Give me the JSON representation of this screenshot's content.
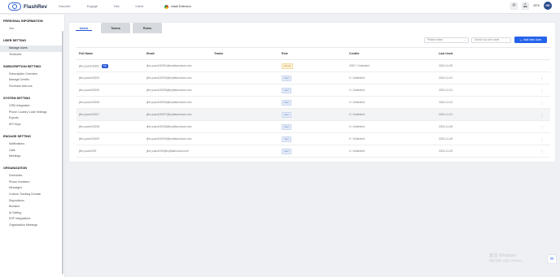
{
  "app": {
    "name": "FlashRev"
  },
  "topnav": {
    "items": [
      "Discover",
      "Engage",
      "Dial",
      "Intent"
    ]
  },
  "extension": {
    "label": "Install Extension"
  },
  "header": {
    "credits": "257K",
    "avatar_initials": "HD"
  },
  "sidebar": {
    "sections": [
      {
        "title": "PERSONAL INFORMATION",
        "items": [
          "You"
        ]
      },
      {
        "title": "USER SETTING",
        "items": [
          "Manage Users",
          "Territories"
        ],
        "active": "Manage Users"
      },
      {
        "title": "SUBSCRIPTION SETTING",
        "items": [
          "Subscription Overview",
          "Manage Credits",
          "Purchase Add-ons"
        ]
      },
      {
        "title": "SYSTEM SETTING",
        "items": [
          "CRM Integration",
          "Phone Country Code Settings",
          "Exports",
          "API Keys"
        ]
      },
      {
        "title": "ENGAGE SETTING",
        "items": [
          "Notifications",
          "Calls",
          "Meetings"
        ]
      },
      {
        "title": "ORGANIZATION",
        "items": [
          "Schedules",
          "Phone Numbers",
          "Messages",
          "Custom Tracking Domain",
          "Dispositions",
          "Blocklist",
          "AI Setting",
          "ESP Integrations",
          "Organization Meetings"
        ]
      }
    ]
  },
  "tabs": [
    "Users",
    "Teams",
    "Roles"
  ],
  "toolbar": {
    "select_placeholder": "Please select",
    "search_placeholder": "Search by user name",
    "add_label": "Add New User"
  },
  "table": {
    "columns": [
      "Full Name",
      "Email",
      "Teams",
      "Role",
      "Credits",
      "Last Used"
    ],
    "me_badge": "Me",
    "rows": [
      {
        "name": "jihe-yuan100391",
        "email": "jihe.yuan100391@myflashcloud.com",
        "teams": "",
        "role": "Owner",
        "credits": "2057 / Unlimited",
        "last_used": "2024-11-09",
        "me": true
      },
      {
        "name": "jihe-yuan100203",
        "email": "jihe.yuan100203@myflashcloud.com",
        "teams": "",
        "role": "User",
        "credits": "0 / Unlimited",
        "last_used": "2024-11-01",
        "me": false
      },
      {
        "name": "jihe-yuan100205",
        "email": "jihe.yuan100205@myflashcloud.com",
        "teams": "",
        "role": "User",
        "credits": "0 / Unlimited",
        "last_used": "2024-11-01",
        "me": false
      },
      {
        "name": "jihe-yuan100206",
        "email": "jihe.yuan100206@myflashcloud.com",
        "teams": "",
        "role": "User",
        "credits": "0 / Unlimited",
        "last_used": "2024-11-01",
        "me": false
      },
      {
        "name": "jihe-yuan100207",
        "email": "jihe.yuan100207@myflashcloud.com",
        "teams": "",
        "role": "User",
        "credits": "0 / Unlimited",
        "last_used": "2024-11-01",
        "me": false
      },
      {
        "name": "jihe-yuan100208",
        "email": "jihe.yuan100208@myflashcloud.com",
        "teams": "",
        "role": "User",
        "credits": "0 / Unlimited",
        "last_used": "2024-11-06",
        "me": false
      },
      {
        "name": "jihe-yuan100209",
        "email": "jihe.yuan100209@myflashcloud.com",
        "teams": "",
        "role": "User",
        "credits": "0 / Unlimited",
        "last_used": "2024-11-06",
        "me": false
      },
      {
        "name": "jihe-yuan1029",
        "email": "jihe.yuan1029@myflashcloud.com",
        "teams": "",
        "role": "User",
        "credits": "0 / Unlimited",
        "last_used": "2024-11-09",
        "me": false
      }
    ]
  },
  "watermark": {
    "line1": "激活 Windows",
    "line2": "转到\"设置\"以激活 Windows。"
  }
}
